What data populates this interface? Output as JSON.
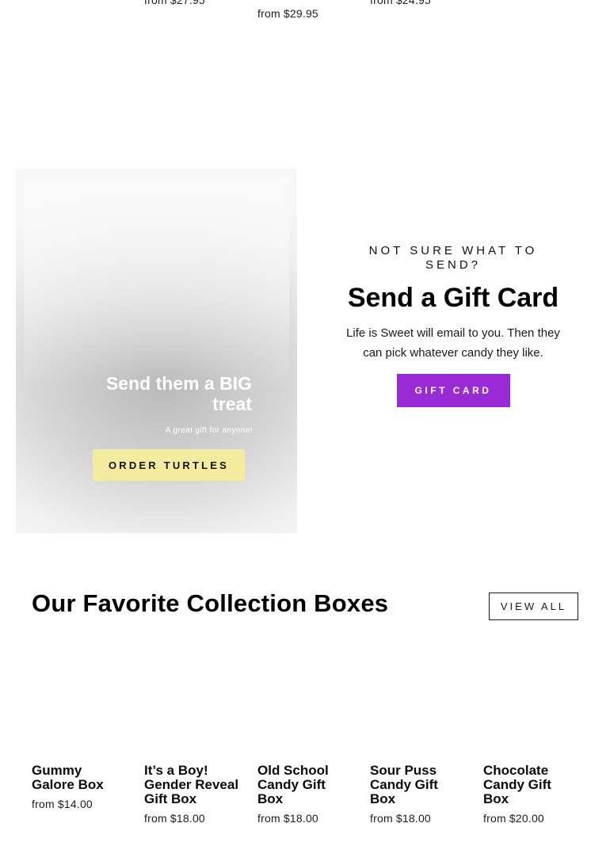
{
  "top_prices": [
    "from $27.95",
    "from $29.95",
    "from $24.95"
  ],
  "promo": {
    "heading": "Send them a BIG treat",
    "subtext": "A great gift for anyone!",
    "button_label": "ORDER TURTLES"
  },
  "gift_card": {
    "eyebrow": "NOT SURE WHAT TO SEND?",
    "title": "Send a Gift Card",
    "description": "Life is Sweet will email to you. Then they can pick whatever candy they like.",
    "button_label": "GIFT CARD"
  },
  "collection": {
    "title": "Our Favorite Collection Boxes",
    "view_all_label": "VIEW ALL",
    "products": [
      {
        "name": "Gummy Galore Box",
        "price": "from $14.00"
      },
      {
        "name": "It’s a Boy! Gender Reveal Gift Box",
        "price": "from $18.00"
      },
      {
        "name": "Old School Candy Gift Box",
        "price": "from $18.00"
      },
      {
        "name": "Sour Puss Candy Gift Box",
        "price": "from $18.00"
      },
      {
        "name": "Chocolate Candy Gift Box",
        "price": "from $20.00"
      }
    ]
  },
  "colors": {
    "gift_button": "#9a2ad6",
    "promo_button": "#f3ec9f"
  }
}
